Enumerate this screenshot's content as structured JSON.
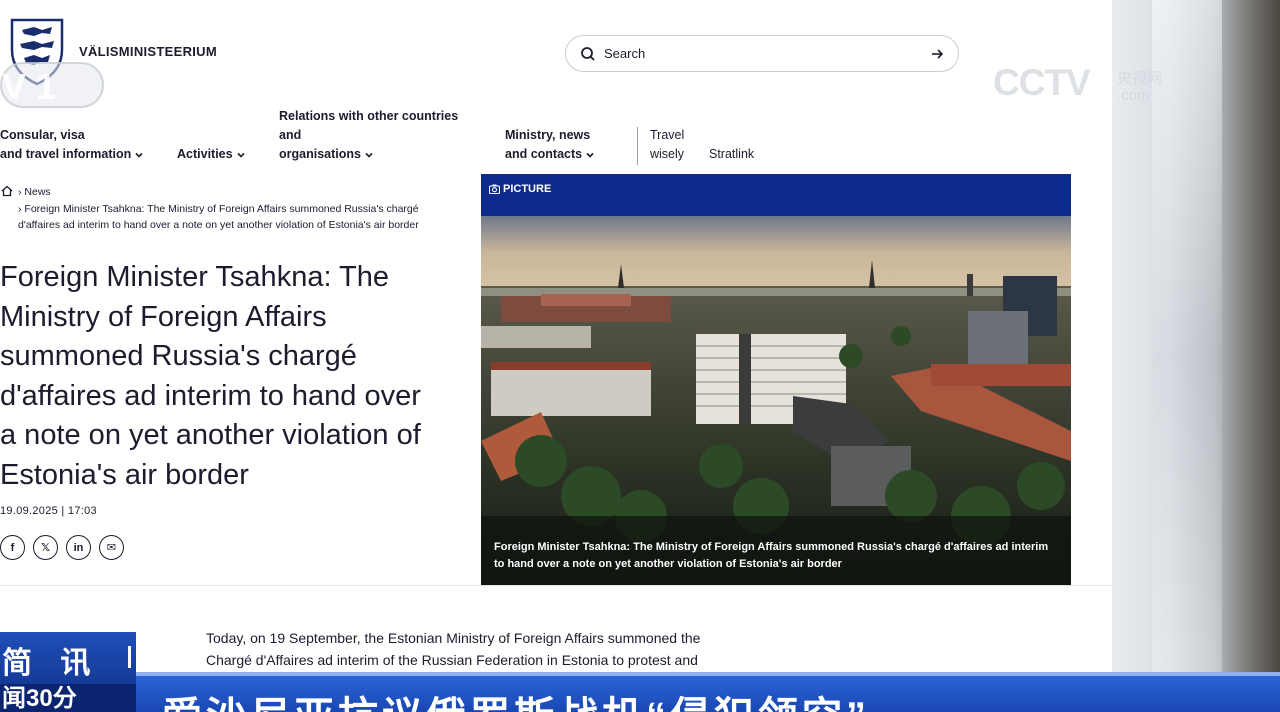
{
  "header": {
    "site_name": "VÄLISMINISTEERIUM",
    "search_placeholder": "Search"
  },
  "nav": {
    "items": [
      {
        "line1": "Consular, visa",
        "line2": "and travel information"
      },
      {
        "line1": "Activities"
      },
      {
        "line1": "Relations with other countries",
        "line2": "and",
        "line3": "organisations"
      },
      {
        "line1": "Ministry, news",
        "line2": "and contacts"
      }
    ],
    "travel_line1": "Travel",
    "travel_line2": "wisely",
    "stratlink": "Stratlink"
  },
  "breadcrumb": {
    "level1": "News",
    "current_line1": "Foreign Minister Tsahkna: The Ministry of Foreign Affairs summoned Russia's chargé",
    "current_line2": "d'affaires ad interim to hand over a note on yet another violation of Estonia's air border"
  },
  "article": {
    "title_lines": [
      "Foreign Minister Tsahkna: The",
      "Ministry of Foreign Affairs",
      "summoned Russia's chargé",
      "d'affaires ad interim to hand over",
      "a note on yet another violation of",
      "Estonia's air border"
    ],
    "date": "19.09.2025 | 17:03",
    "share": {
      "facebook": "f",
      "x": "𝕏",
      "linkedin": "in",
      "email": "✉"
    },
    "picture_label": "PICTURE",
    "caption": "Foreign Minister Tsahkna: The Ministry of Foreign Affairs summoned Russia's chargé d'affaires ad interim to hand over a note on yet another violation of Estonia's air border",
    "body_line1": "Today, on 19 September, the Estonian Ministry of Foreign Affairs summoned the",
    "body_line2": "Chargé d'Affaires ad interim of the Russian Federation in Estonia to protest and"
  },
  "overlay": {
    "channel_logo": "CCTV",
    "channel_cn_line1": "央视网",
    "channel_cn_line2": ".com",
    "left_mark": "V 1",
    "ticker_tag": "简 讯",
    "ticker_program": "闻30分",
    "ticker_headline": "爱沙尼亚抗议俄罗斯战机“侵犯领空”"
  },
  "colors": {
    "brand_blue": "#0d2a8c",
    "text": "#1c1c2e",
    "ticker_blue": "#1947b2"
  }
}
